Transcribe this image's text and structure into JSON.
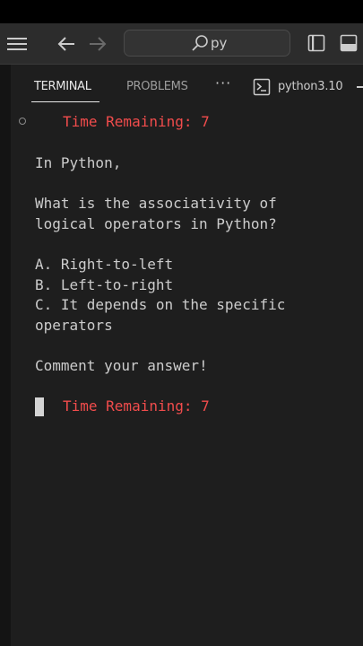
{
  "titlebar": {
    "search_query": "py",
    "icons": [
      "menu-icon",
      "arrow-left-icon",
      "arrow-right-icon",
      "search-icon",
      "toggle-sidebar-icon",
      "toggle-panel-icon"
    ]
  },
  "panel": {
    "tabs": [
      {
        "label": "TERMINAL",
        "active": true
      },
      {
        "label": "PROBLEMS",
        "active": false
      }
    ],
    "more_label": "···",
    "terminal_instance": "python3.10"
  },
  "terminal": {
    "timer_top": "Time Remaining: 7",
    "lines": [
      "In Python,",
      "What is the associativity of",
      "logical operators in Python?",
      "A. Right-to-left",
      "B. Left-to-right",
      "C. It depends on the specific",
      "operators",
      "Comment your answer!"
    ],
    "timer_bottom": "Time Remaining: 7"
  },
  "colors": {
    "accent_red": "#f14c4c",
    "text": "#cccccc",
    "background": "#1e1e1e"
  }
}
